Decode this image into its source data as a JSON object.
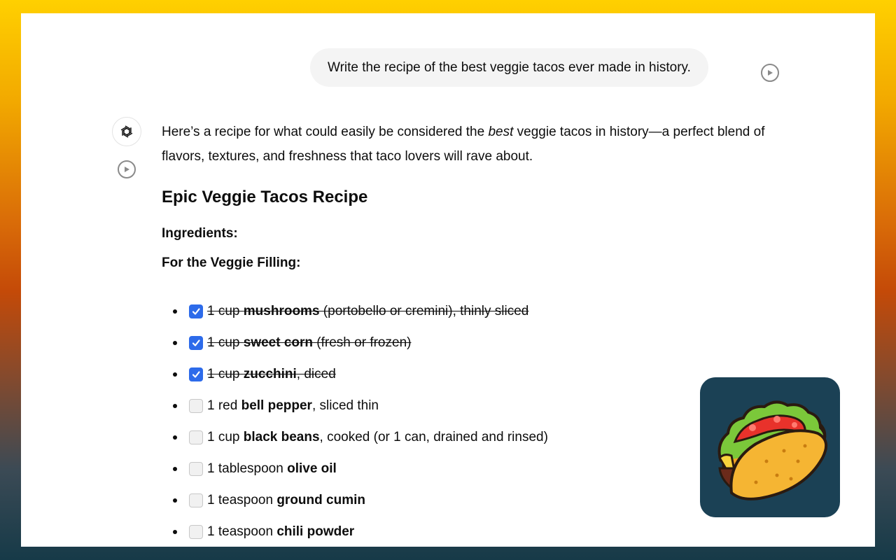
{
  "user_message": "Write the recipe of the best veggie tacos ever made in history.",
  "assistant": {
    "intro_before": "Here’s a recipe for what could easily be considered the ",
    "intro_em": "best",
    "intro_after": " veggie tacos in history—a perfect blend of flavors, textures, and freshness that taco lovers will rave about.",
    "heading": "Epic Veggie Tacos Recipe",
    "ingredients_label": "Ingredients:",
    "filling_label": "For the Veggie Filling:",
    "ingredients": [
      {
        "checked": true,
        "pre": "1 cup ",
        "bold": "mushrooms",
        "post": " (portobello or cremini), thinly sliced"
      },
      {
        "checked": true,
        "pre": "1 cup ",
        "bold": "sweet corn",
        "post": " (fresh or frozen)"
      },
      {
        "checked": true,
        "pre": "1 cup ",
        "bold": "zucchini",
        "post": ", diced"
      },
      {
        "checked": false,
        "pre": "1 red ",
        "bold": "bell pepper",
        "post": ", sliced thin"
      },
      {
        "checked": false,
        "pre": "1 cup ",
        "bold": "black beans",
        "post": ", cooked (or 1 can, drained and rinsed)"
      },
      {
        "checked": false,
        "pre": "1 tablespoon ",
        "bold": "olive oil",
        "post": ""
      },
      {
        "checked": false,
        "pre": "1 teaspoon ",
        "bold": "ground cumin",
        "post": ""
      },
      {
        "checked": false,
        "pre": "1 teaspoon ",
        "bold": "chili powder",
        "post": ""
      }
    ]
  },
  "icons": {
    "assistant_avatar": "openai-logo-icon",
    "play": "play-circle-icon",
    "checkbox_tick": "check-icon",
    "app_icon": "taco-icon"
  },
  "colors": {
    "checkbox_checked": "#2d6bea",
    "user_bubble": "#f4f4f4",
    "app_icon_bg": "#1b4155"
  }
}
